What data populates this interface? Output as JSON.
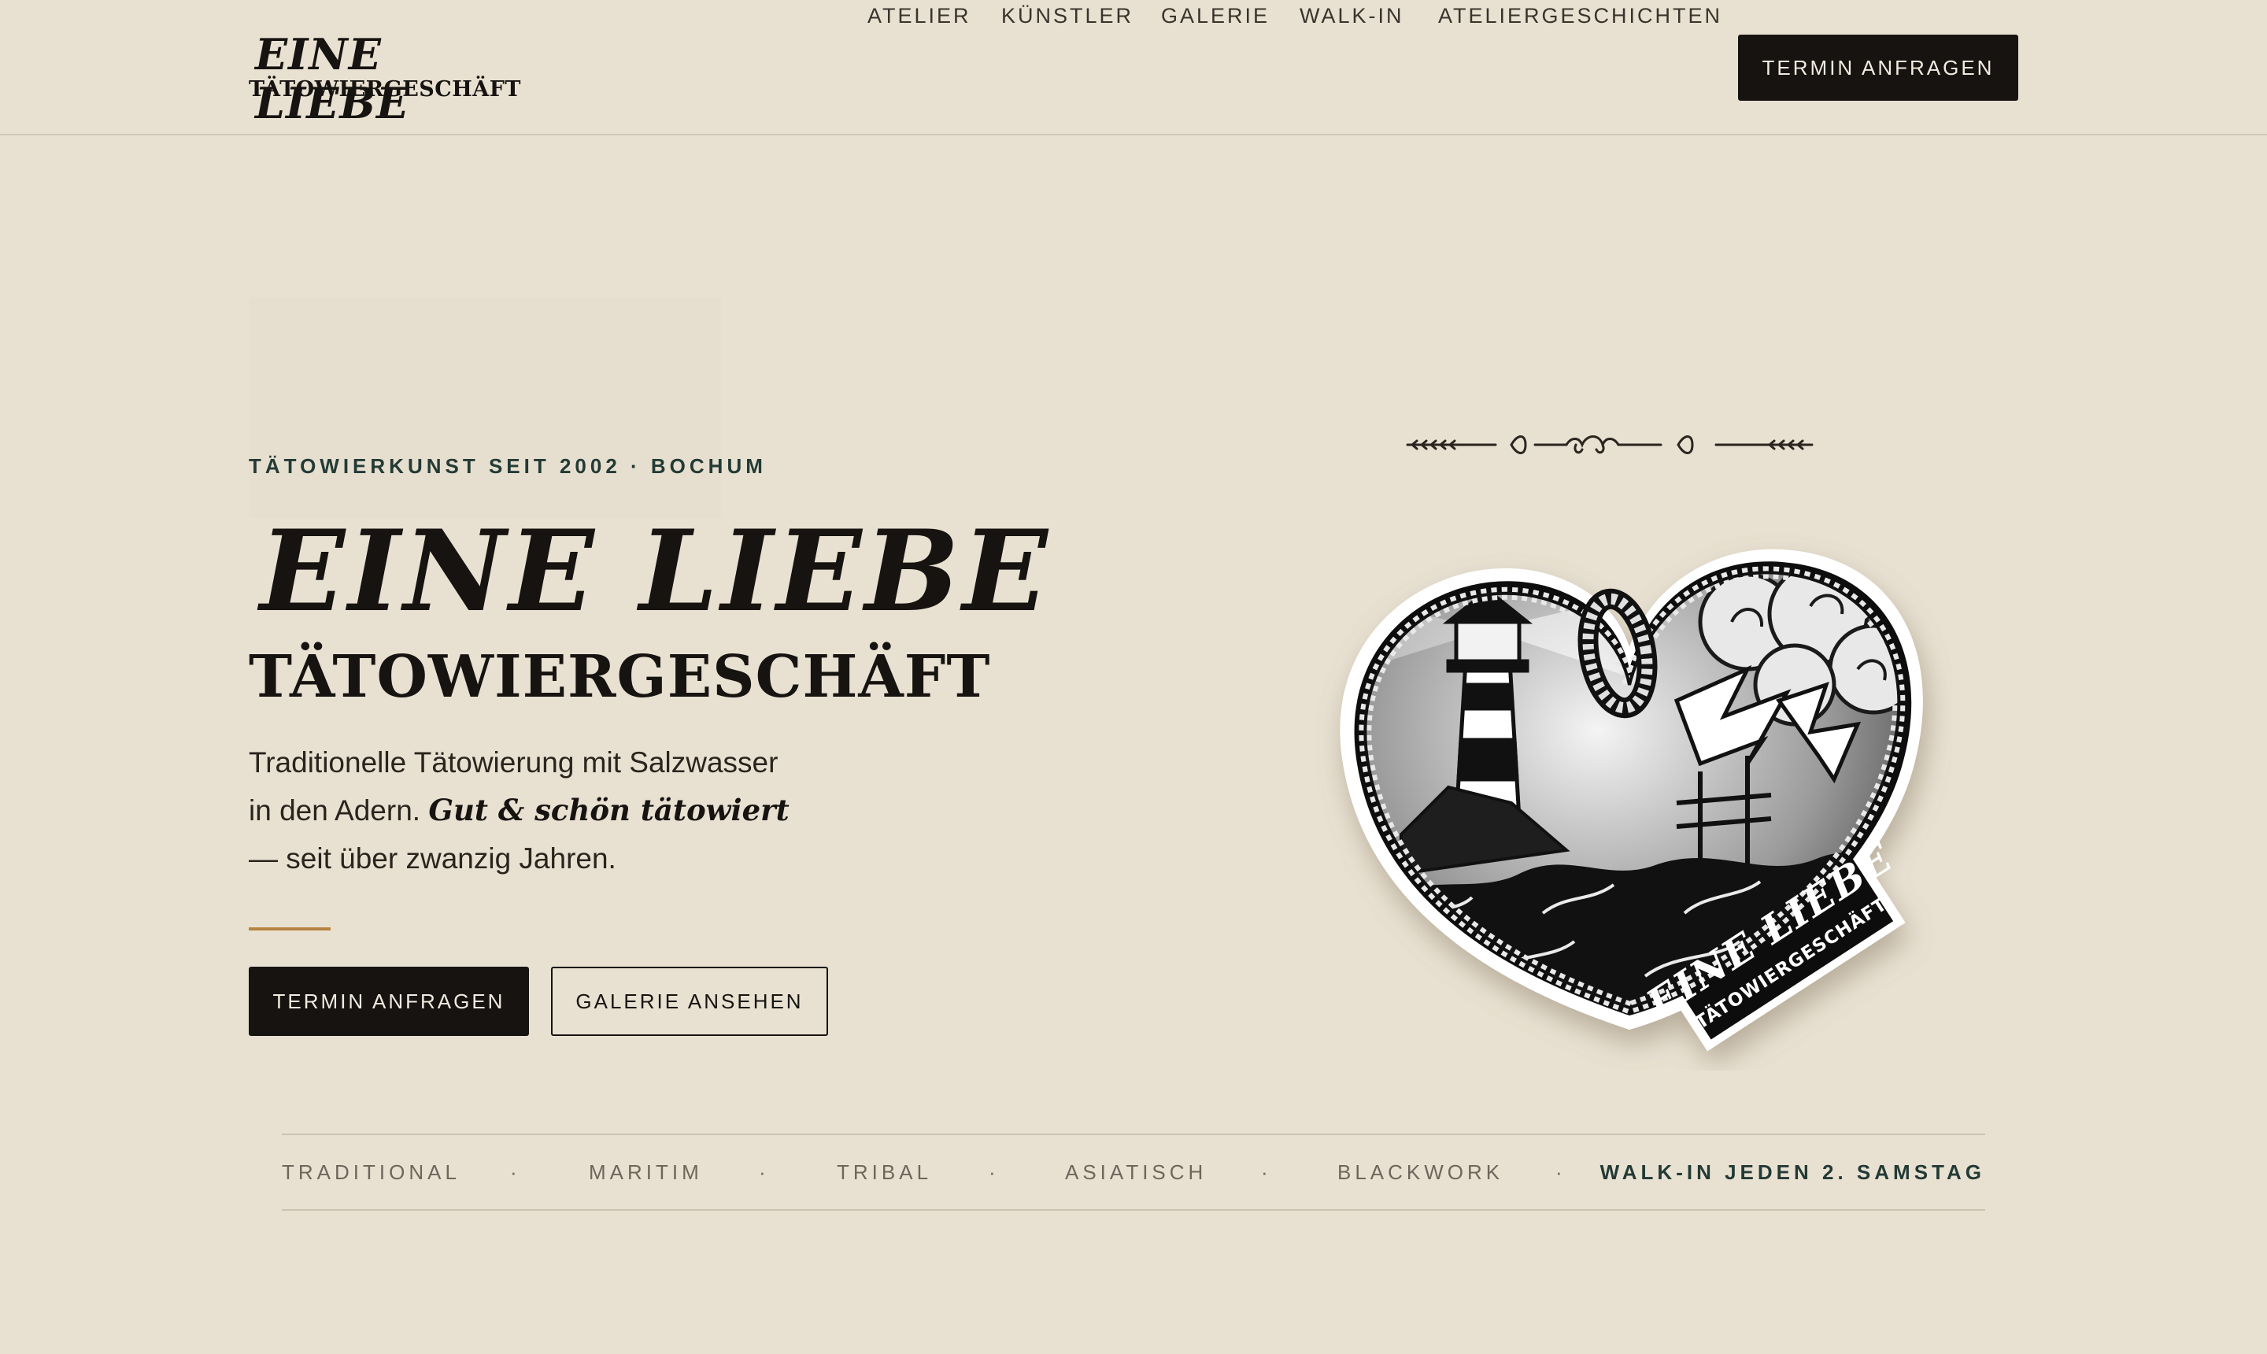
{
  "header": {
    "logo_top": "EINE LIEBE",
    "logo_bottom": "TÄTOWIERGESCHÄFT",
    "nav": [
      "ATELIER",
      "KÜNSTLER",
      "GALERIE",
      "WALK-IN",
      "ATELIERGESCHICHTEN"
    ],
    "cta_label": "TERMIN ANFRAGEN"
  },
  "hero": {
    "eyebrow": "TÄTOWIERKUNST SEIT 2002 · BOCHUM",
    "title": "EINE LIEBE",
    "subtitle": "TÄTOWIERGESCHÄFT",
    "text_part1": "Traditionelle Tätowierung mit Salzwasser in den Adern.",
    "text_emphasis": "Gut & schön tätowiert",
    "text_part2": "— seit über zwanzig Jahren.",
    "primary_button": "TERMIN ANFRAGEN",
    "secondary_button": "GALERIE ANSEHEN",
    "badge_banner_top": "EINE LIEBE",
    "badge_banner_bottom": "TÄTOWIERGESCHÄFT"
  },
  "styles_strip": {
    "items": [
      "TRADITIONAL",
      "MARITIM",
      "TRIBAL",
      "ASIATISCH",
      "BLACKWORK"
    ],
    "separator": "·",
    "highlight": "WALK-IN JEDEN 2. SAMSTAG"
  },
  "colors": {
    "background": "#e8e1d2",
    "ink": "#161310",
    "accent_gold": "#b7843f",
    "accent_green": "#233a35"
  },
  "icons": [
    "flourish-ornament-icon",
    "heart-lighthouse-badge-icon"
  ]
}
